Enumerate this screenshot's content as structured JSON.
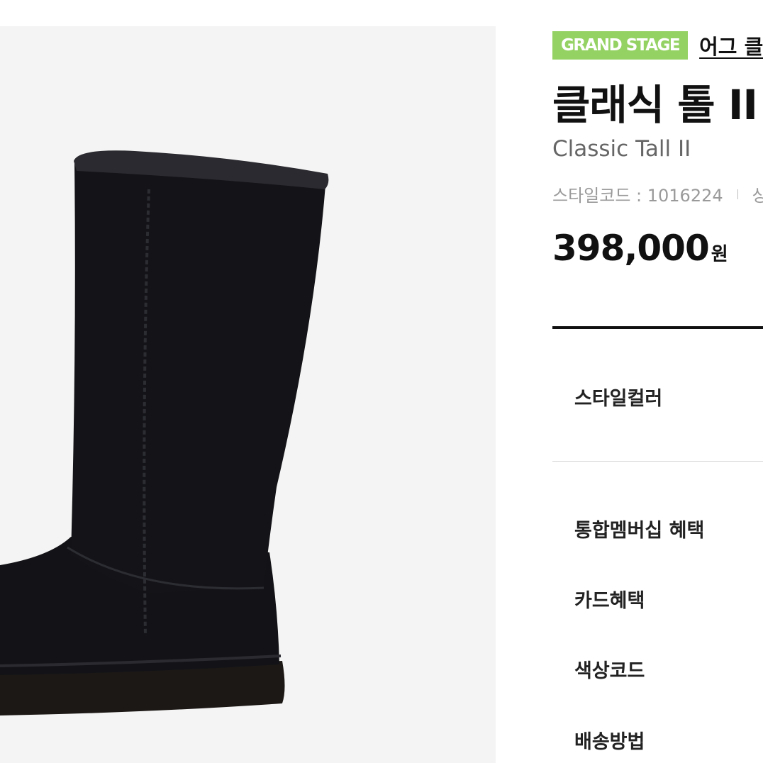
{
  "product": {
    "store_badge": "GRAND STAGE",
    "brand": "어그 클",
    "name_ko": "클래식 톨 II",
    "name_en": "Classic Tall II",
    "style_code_label": "스타일코드 : 1016224",
    "next_meta_partial": "상",
    "price": "398,000",
    "currency_unit": "원",
    "image_alt": "black-suede-tall-boot"
  },
  "options": {
    "style_color_label": "스타일컬러",
    "membership_benefit_label": "통합멤버십 혜택",
    "card_benefit_label": "카드혜택",
    "color_code_label": "색상코드",
    "shipping_method_label": "배송방법"
  },
  "colors": {
    "badge_bg": "#95d264",
    "gallery_bg": "#f4f4f4",
    "boot": "#141418",
    "text_dark": "#111111",
    "text_muted": "#9a9a9a"
  }
}
